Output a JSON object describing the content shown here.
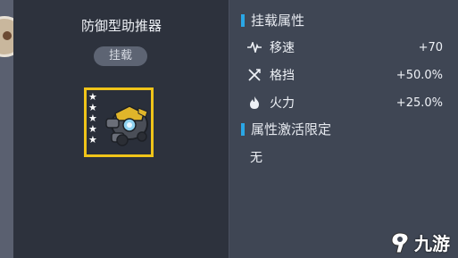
{
  "item": {
    "name": "防御型助推器",
    "status_badge": "挂载",
    "star_rating": 5
  },
  "attributes": {
    "title": "挂载属性",
    "rows": [
      {
        "label": "移速",
        "value": "+70",
        "icon": "speed-icon"
      },
      {
        "label": "格挡",
        "value": "+50.0%",
        "icon": "block-icon"
      },
      {
        "label": "火力",
        "value": "+25.0%",
        "icon": "fire-icon"
      }
    ]
  },
  "activation": {
    "title": "属性激活限定",
    "value": "无"
  },
  "watermark": {
    "text": "九游"
  },
  "colors": {
    "accent": "#2aa7e6",
    "frame_gold": "#f0c419"
  }
}
